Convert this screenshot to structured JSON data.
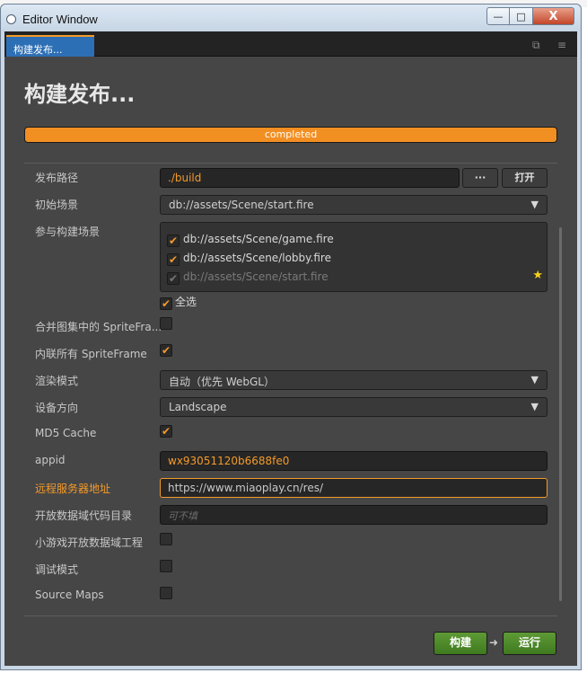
{
  "window": {
    "title": "Editor Window",
    "minimize_label": "—",
    "maximize_label": "□",
    "close_label": "X"
  },
  "tab": {
    "label": "构建发布..."
  },
  "panel": {
    "heading": "构建发布...",
    "progress": {
      "text": "completed",
      "value": 1.0
    }
  },
  "fields": {
    "build_path": {
      "label": "发布路径",
      "value": "./build",
      "browse_label": "···",
      "open_label": "打开"
    },
    "start_scene": {
      "label": "初始场景",
      "value": "db://assets/Scene/start.fire"
    },
    "scenes": {
      "label": "参与构建场景",
      "items": [
        {
          "path": "db://assets/Scene/game.fire",
          "checked": true
        },
        {
          "path": "db://assets/Scene/lobby.fire",
          "checked": true
        },
        {
          "path": "db://assets/Scene/start.fire",
          "checked": true
        }
      ],
      "select_all_label": "全选"
    },
    "merge_spriteframe": {
      "label": "合并图集中的 SpriteFra..."
    },
    "inline_spriteframe": {
      "label": "内联所有 SpriteFrame"
    },
    "render_mode": {
      "label": "渲染模式",
      "value": "自动（优先 WebGL）"
    },
    "orientation": {
      "label": "设备方向",
      "value": "Landscape"
    },
    "md5_cache": {
      "label": "MD5 Cache"
    },
    "appid": {
      "label": "appid",
      "value": "wx93051120b6688fe0"
    },
    "remote_server": {
      "label": "远程服务器地址",
      "value": "https://www.miaoplay.cn/res/"
    },
    "open_data_dir": {
      "label": "开放数据域代码目录",
      "placeholder": "可不填"
    },
    "open_data_project": {
      "label": "小游戏开放数据域工程"
    },
    "debug_mode": {
      "label": "调试模式"
    },
    "source_maps": {
      "label": "Source Maps"
    }
  },
  "actions": {
    "build_label": "构建",
    "arrow": "➜",
    "run_label": "运行"
  },
  "colors": {
    "accent": "#f39a2a",
    "tab_blue": "#2d6fb5",
    "button_green": "#4f8a2a",
    "panel_bg": "#464646"
  }
}
